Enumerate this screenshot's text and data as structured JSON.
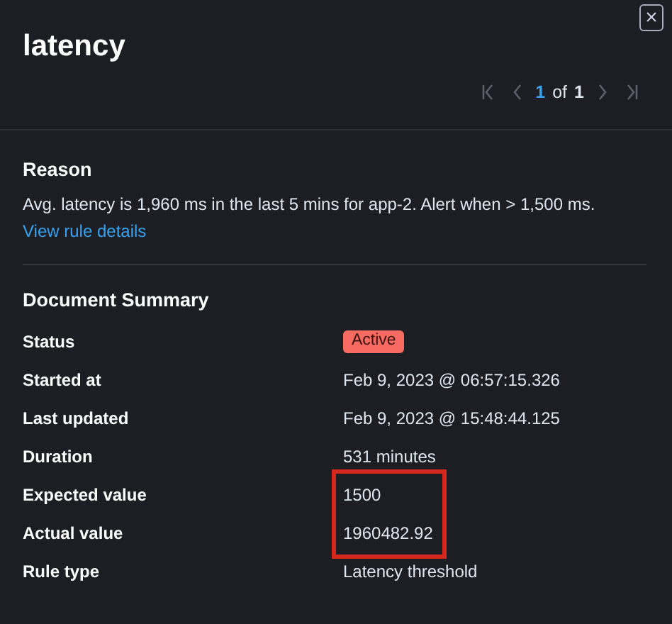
{
  "flyout": {
    "title": "latency",
    "close_icon": "×"
  },
  "pager": {
    "current": "1",
    "separator": "of",
    "total": "1",
    "first_disabled": true,
    "prev_disabled": true,
    "next_disabled": true,
    "last_disabled": true
  },
  "reason": {
    "heading": "Reason",
    "text": "Avg. latency is 1,960 ms in the last 5 mins for app-2. Alert when > 1,500 ms.",
    "link": "View rule details"
  },
  "summary": {
    "heading": "Document Summary",
    "rows": [
      {
        "label": "Status",
        "value": "Active",
        "kind": "badge",
        "highlighted": false
      },
      {
        "label": "Started at",
        "value": "Feb 9, 2023 @ 06:57:15.326",
        "kind": "text",
        "highlighted": false
      },
      {
        "label": "Last updated",
        "value": "Feb 9, 2023 @ 15:48:44.125",
        "kind": "text",
        "highlighted": false
      },
      {
        "label": "Duration",
        "value": "531 minutes",
        "kind": "text",
        "highlighted": false
      },
      {
        "label": "Expected value",
        "value": "1500",
        "kind": "text",
        "highlighted": true
      },
      {
        "label": "Actual value",
        "value": "1960482.92",
        "kind": "text",
        "highlighted": true
      },
      {
        "label": "Rule type",
        "value": "Latency threshold",
        "kind": "text",
        "highlighted": false
      }
    ]
  }
}
